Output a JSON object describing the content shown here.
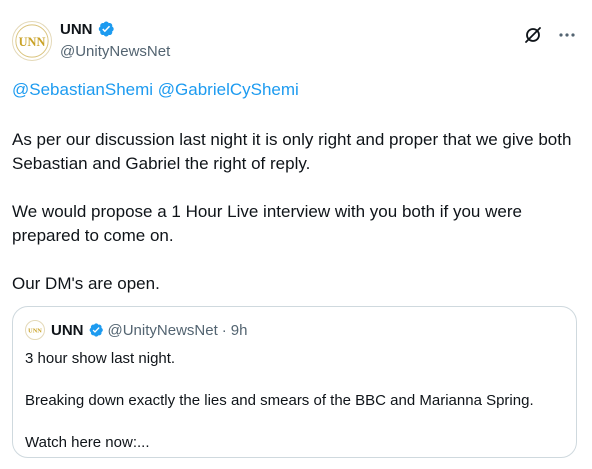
{
  "author": {
    "display_name": "UNN",
    "handle": "@UnityNewsNet",
    "avatar_text": "UNN"
  },
  "header_actions": {
    "grok_icon": "grok-icon",
    "more_icon": "more-options-icon"
  },
  "tweet": {
    "mentions": [
      "@SebastianShemi",
      "@GabrielCyShemi"
    ],
    "paragraphs": [
      "As per our discussion last night it is only right and proper that we give both Sebastian and Gabriel the right of reply.",
      "We would propose a 1 Hour Live interview with you both if you were prepared to come on.",
      "Our DM's are open."
    ]
  },
  "quote": {
    "display_name": "UNN",
    "handle": "@UnityNewsNet",
    "separator": "·",
    "time": "9h",
    "paragraphs": [
      "3 hour show last night.",
      "Breaking down exactly the lies and smears of the BBC and Marianna Spring.",
      "Watch here now:..."
    ]
  },
  "colors": {
    "accent": "#1d9bf0",
    "verified": "#1d9bf0",
    "muted": "#536471",
    "border": "#cfd9de",
    "logo_gold": "#c9a227"
  }
}
